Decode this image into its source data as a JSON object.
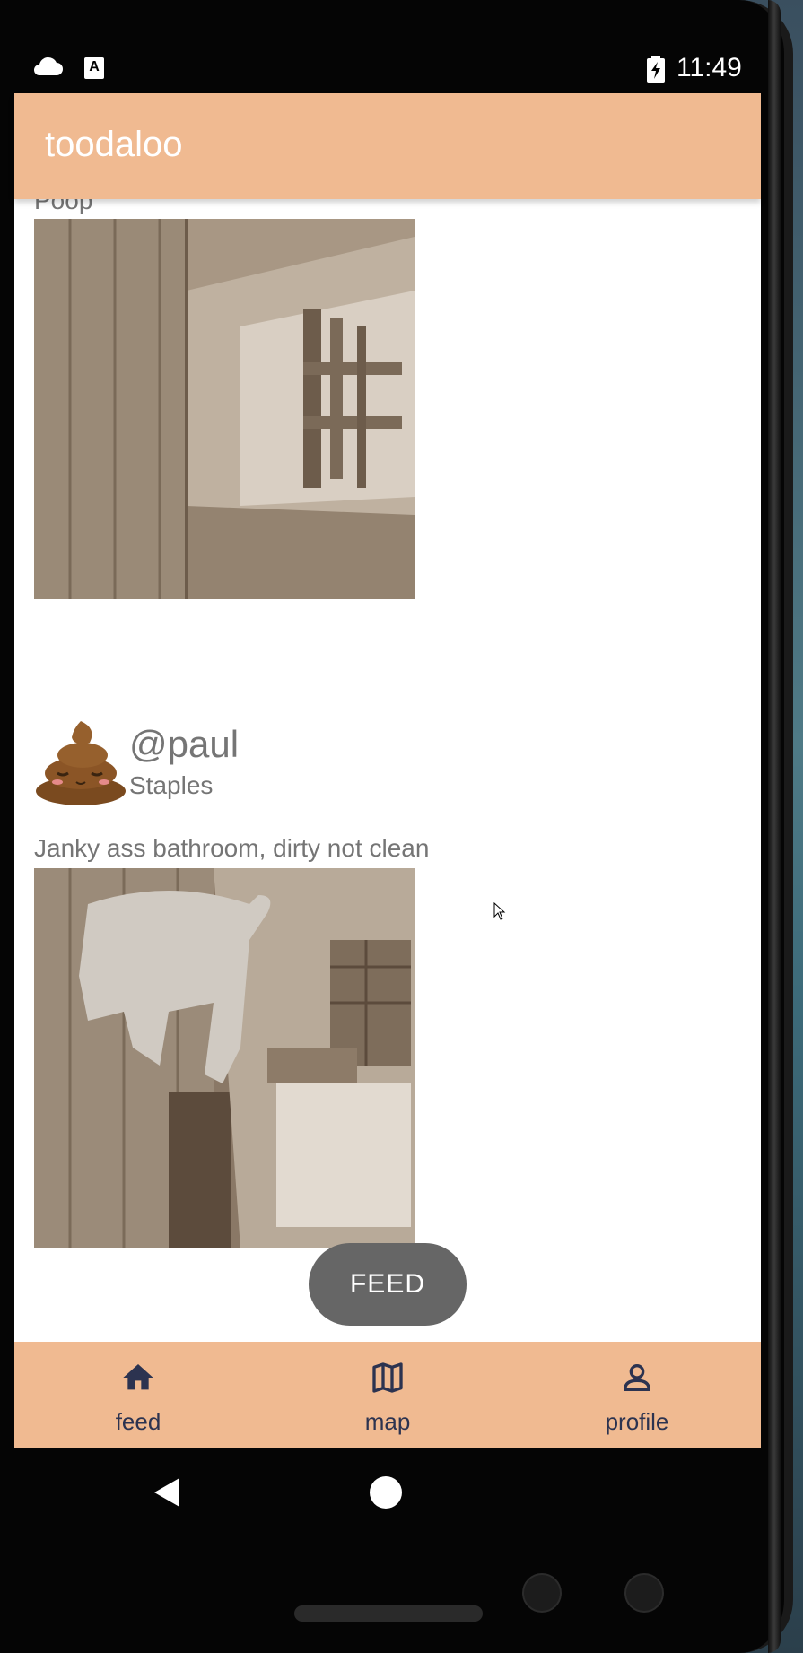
{
  "status_bar": {
    "time": "11:49",
    "icons": [
      "cloud-icon",
      "a-notification-icon",
      "battery-charging-icon"
    ]
  },
  "app_bar": {
    "title": "toodaloo"
  },
  "feed": {
    "posts": [
      {
        "caption": "Poop",
        "photo": "bathroom-photo-dining-room"
      },
      {
        "username": "@paul",
        "location": "Staples",
        "avatar": "poop-emoji-avatar",
        "caption": "Janky ass bathroom, dirty not clean",
        "photo": "bathroom-photo-dog-room"
      }
    ]
  },
  "fab": {
    "label": "FEED"
  },
  "bottom_nav": {
    "items": [
      {
        "label": "feed",
        "icon": "home-icon"
      },
      {
        "label": "map",
        "icon": "map-icon"
      },
      {
        "label": "profile",
        "icon": "person-icon"
      }
    ]
  },
  "colors": {
    "accent": "#f0ba91",
    "nav_text": "#2c3350",
    "secondary_text": "#757575",
    "fab": "#666666"
  }
}
